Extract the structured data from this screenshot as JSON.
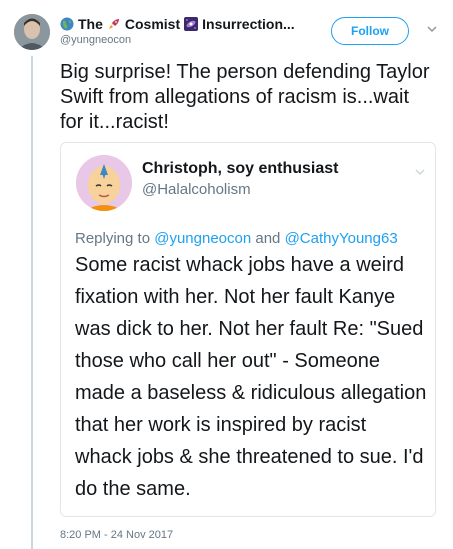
{
  "author": {
    "display_name_parts": [
      "The",
      "Cosmist",
      "Insurrection..."
    ],
    "name_emojis": [
      "globe-emoji",
      "rocket-emoji",
      "galaxy-emoji"
    ],
    "handle": "@yungneocon"
  },
  "follow_label": "Follow",
  "tweet_text": "Big surprise! The person defending Taylor Swift from allegations of racism is...wait for it...racist!",
  "quoted": {
    "name": "Christoph, soy enthusiast",
    "handle": "@Halalcoholism",
    "replying_prefix": "Replying to",
    "replying_user1": "@yungneocon",
    "replying_and": "and",
    "replying_user2": "@CathyYoung63",
    "text": "Some racist whack jobs have a weird fixation with her. Not her fault Kanye was dick to her. Not her fault Re: \"Sued those who call her out\" - Someone made a baseless & ridiculous allegation that her work is inspired by racist whack jobs & she threatened to sue. I'd do the same."
  },
  "timestamp": "8:20 PM - 24 Nov 2017",
  "colors": {
    "accent": "#1da1f2",
    "secondary_text": "#657786",
    "border": "#e1e8ed"
  }
}
